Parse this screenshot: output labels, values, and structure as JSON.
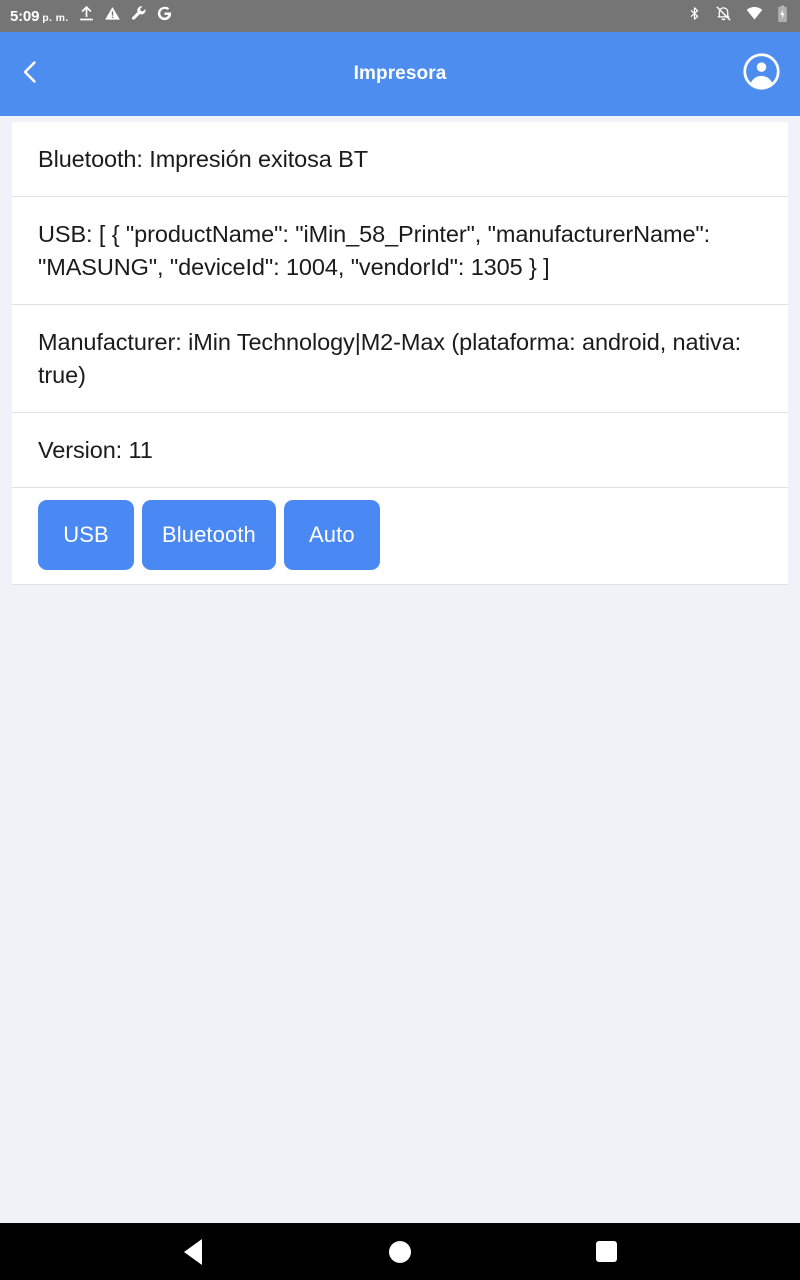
{
  "status_bar": {
    "time": "5:09",
    "meridiem": "p. m.",
    "left_icons": [
      "upload-icon",
      "warning-icon",
      "wrench-icon",
      "google-g-icon"
    ],
    "right_icons": [
      "bluetooth-icon",
      "notifications-off-icon",
      "wifi-icon",
      "battery-icon"
    ],
    "background_color": "#757575"
  },
  "app_bar": {
    "title": "Impresora",
    "back_icon": "chevron-left-icon",
    "account_icon": "account-circle-icon",
    "background_color": "#4d8df0"
  },
  "card": {
    "rows": [
      {
        "text": "Bluetooth: Impresión exitosa BT"
      },
      {
        "text": "USB: [ { \"productName\": \"iMin_58_Printer\", \"manufacturerName\": \"MASUNG\", \"deviceId\": 1004, \"vendorId\": 1305 } ]"
      },
      {
        "text": "Manufacturer: iMin Technology|M2-Max (plataforma: android, nativa: true)"
      },
      {
        "text": "Version: 11"
      }
    ],
    "buttons": [
      {
        "label": "USB"
      },
      {
        "label": "Bluetooth"
      },
      {
        "label": "Auto"
      }
    ],
    "button_color": "#4a89f3",
    "background_color": "#ffffff"
  },
  "page": {
    "background_color": "#eff3f7"
  },
  "nav_bar": {
    "back_icon": "triangle-back-icon",
    "home_icon": "circle-home-icon",
    "recents_icon": "square-recents-icon",
    "background_color": "#000000"
  }
}
